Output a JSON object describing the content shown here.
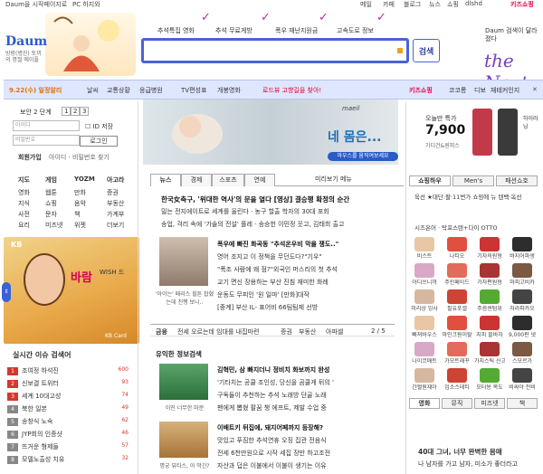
{
  "topbar": {
    "start_page": "Daum을 시작페이지로",
    "pc_alarm": "PC 하지와",
    "links": [
      "메일",
      "카페",
      "블로그",
      "뉴스",
      "쇼핑",
      "dlshd"
    ],
    "shopping_badge": "키즈쇼핑"
  },
  "header": {
    "logo": "Daum",
    "logo_sub": "방랑(병진) 토끼의 명절 에이플",
    "quicklinks": [
      "추석특집 영화",
      "추석 무료게방",
      "폭우 재난지원금",
      "고속도로 정보"
    ],
    "search_button": "검색",
    "search_value": "",
    "promo_text": "Daum 검색이 달라졌다",
    "next_logo": "the Next"
  },
  "navbar": {
    "date_item": "9.22(수) 일정알리",
    "items": [
      "날씨",
      "교통상황",
      "응급병원",
      "TV편성표",
      "개봉영화"
    ],
    "promo": "로드뷰 고향길을 찾아!",
    "right_badge": "키즈쇼핑",
    "right_items": [
      "코코롱",
      "디보",
      "재테커인지"
    ]
  },
  "login": {
    "safe_label": "보안 2 단계",
    "steps": [
      "1",
      "2",
      "3"
    ],
    "id_placeholder": "아이디",
    "pw_placeholder": "비밀번호",
    "save_id": "ID 저장",
    "login_button": "로그인",
    "join": "회원가입",
    "find": "아이디 · 비밀번호 찾기"
  },
  "services": {
    "headers": [
      "지도",
      "게임",
      "YOZM",
      "아고라"
    ],
    "rows": [
      [
        "영화",
        "웹툰",
        "만화",
        "증권"
      ],
      [
        "지식",
        "쇼핑",
        "음악",
        "부동산"
      ],
      [
        "사전",
        "문자",
        "책",
        "가계부"
      ],
      [
        "요리",
        "미즈넷",
        "위젯",
        "더보기"
      ]
    ]
  },
  "banner": {
    "brand": "KB",
    "title": "바람",
    "subtitle": "WISH 드",
    "card": "KB Card"
  },
  "issues": {
    "title": "실시간 이슈 검색어",
    "items": [
      {
        "rank": "1",
        "text": "조여정 하석진",
        "count": "600"
      },
      {
        "rank": "2",
        "text": "신보결 트위터",
        "count": "93"
      },
      {
        "rank": "3",
        "text": "세계 10대고성",
        "count": "74"
      },
      {
        "rank": "4",
        "text": "북한 일본",
        "count": "49"
      },
      {
        "rank": "5",
        "text": "송창식 노숙",
        "count": "62"
      },
      {
        "rank": "6",
        "text": "JYP회의 인증샷",
        "count": "46"
      },
      {
        "rank": "7",
        "text": "뜨거운 형제들",
        "count": "57"
      },
      {
        "rank": "8",
        "text": "모델노출성 치유",
        "count": "32"
      }
    ]
  },
  "feature": {
    "tag": "maeil",
    "title": "네 몸은...",
    "button": "마우스를 움직여보세요"
  },
  "news_tabs": [
    "뉴스",
    "경제",
    "스포츠",
    "연예"
  ],
  "news_tab_right": "미리보기 메뉴",
  "news": [
    "한국女축구, '위대한 역사'의 문을 열다 [영상] 결승행 확정의 순간",
    "밀는 전지에이트로 세계를 울린다 · 농구 할출 학자의 30대 포회",
    "송업, 걱리 속에 '가솔의 전설' 플레 · 송승헌 이민정 웃고, 김태희 출고"
  ],
  "news2": {
    "headline": "폭우에 빠진 화곡동 \"추석온우비 막을 쟁도..\"",
    "lines": [
      "영어 조지고 이 정책을 무던도다?\"기우\"",
      "\"폭조 사람에 왜 점?\"외국인 머스리의 첫 추석",
      "교기 면신 장용하는 부산 진침 재미한 화례",
      "운동도 무피인 '원 일마' [만화]대작",
      "[중계] 부산 IL- 표어비 66팀팀제 선방"
    ],
    "photo_caption": "'아이는' 패리스 힐튼 잡혔는데 진행 보니.."
  },
  "section_bar": [
    "금융",
    "전세 오르는데 임대를 내집마련",
    "증권",
    "부동산",
    "아파셀"
  ],
  "section_bar_right": "2 / 5",
  "useful_title": "유익한 정보검색",
  "useful": {
    "headline": "김혁민, 삼 빠지더니 정비치 화보까지 완성",
    "lines": [
      "'기타치는 공쿨 조인성, 당신을 곰쿨게 뒤의 '",
      "구독들이 추천하는 추석 노래방 단골 노래",
      "팬에게 뽑혔 팔꿈 챙 에프트, 제발 수업 중"
    ],
    "caption": "이진 너무한 마문"
  },
  "useful2": {
    "headline": "이배트키 뒤집에, 돼지어페까지 등장해?",
    "lines": [
      "맛있고 푸짐한 추석연휴 오징 집관 전음식",
      "전세 6천만원으로 시작 세집 장만 하고조전",
      "자산과 덥은 이불에서 이불이 생기는 이유"
    ],
    "caption": "명궁 뷰티스, 아 막긴?"
  },
  "today": {
    "title": "오늘만 특가",
    "price": "7,900",
    "desc": "가디건&원피스",
    "right": "하이러닝"
  },
  "shop_tabs": [
    "쇼핑하우",
    "Men's",
    "패션쇼호"
  ],
  "shop_line1": "육선 ★대단:팔·11번가 쇼핑에 뉴 텐백·옥선",
  "shop_line2": "시즈온어 · 탁포스텐+다이 OTTO",
  "shop_items": [
    "비스트",
    "나티오",
    "기자의원형",
    "바지어파생",
    "아디쓰니까",
    "주린페이드",
    "가자편원형",
    "마피고비카",
    "미리상 잉사",
    "필유포셀",
    "주름센텀위",
    "자라파카오",
    "빠져바우스",
    "마인크원이랄",
    "지피 블바자",
    "9,000판 넷",
    "나이코매트",
    "가모트래꾸",
    "가지스틱 신고",
    "스모르가",
    "간혈원재아",
    "입소스테티",
    "모터용 목도",
    "비싸야 전비"
  ],
  "media_tabs": [
    "영화",
    "뮤직",
    "미즈넷",
    "책"
  ],
  "right_headline": "40대 그녀, 너무 완벽한 몸매",
  "right_sub": "나 남자를 가고 남자, 미소가 좋더라고"
}
